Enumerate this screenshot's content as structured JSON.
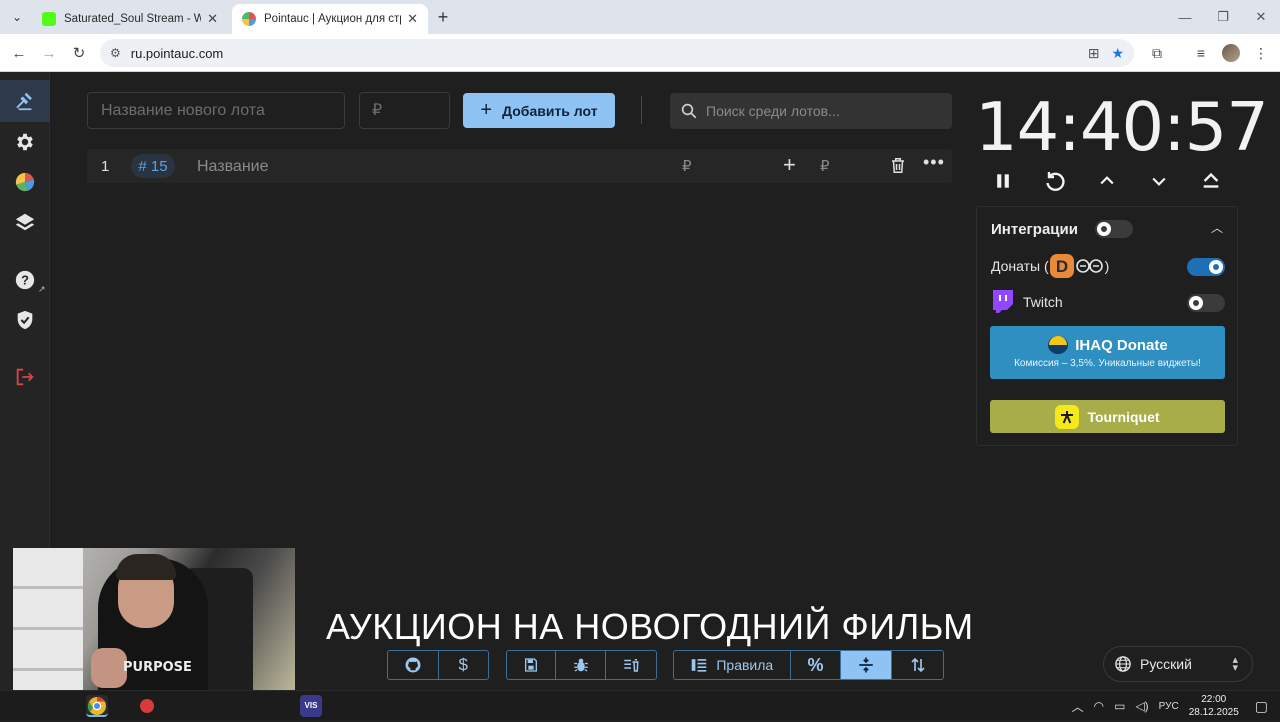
{
  "browser": {
    "tabs": [
      {
        "title": "Saturated_Soul Stream - Watch",
        "active": false,
        "favicon_color": "#53fc18"
      },
      {
        "title": "Pointauc | Аукцион для стриме",
        "active": true,
        "favicon_color": "#e0554a"
      }
    ],
    "url": "ru.pointauc.com"
  },
  "sidebar": {
    "items": [
      {
        "name": "auction",
        "icon": "gavel-icon",
        "active": true
      },
      {
        "name": "settings",
        "icon": "gear-icon"
      },
      {
        "name": "wheel",
        "icon": "pie-wheel-icon"
      },
      {
        "name": "layers",
        "icon": "layers-icon"
      },
      {
        "name": "help",
        "icon": "question-icon"
      },
      {
        "name": "verified",
        "icon": "shield-check-icon"
      },
      {
        "name": "logout",
        "icon": "logout-icon"
      }
    ]
  },
  "toolbar": {
    "lot_name_placeholder": "Название нового лота",
    "amount_placeholder": "₽",
    "add_lot_label": "Добавить лот",
    "search_placeholder": "Поиск среди лотов..."
  },
  "lots": [
    {
      "index": "1",
      "id": "# 15",
      "title": "Название",
      "currency": "₽",
      "add_currency": "₽"
    }
  ],
  "timer": {
    "time": "14:40:57"
  },
  "integrations": {
    "title": "Интеграции",
    "enabled": false,
    "donations_label": "Донаты (",
    "donations_suffix": ")",
    "donations_enabled": true,
    "twitch_label": "Twitch",
    "twitch_enabled": false,
    "ihaq": {
      "title": "IHAQ Donate",
      "subtitle": "Комиссия – 3,5%. Уникальные виджеты!"
    },
    "tourniquet": {
      "title": "Tourniquet"
    }
  },
  "overlay": {
    "title": "АУКЦИОН НА НОВОГОДНИЙ ФИЛЬМ",
    "webcam_shirt_text": "PURPOSE"
  },
  "bottom_bar": {
    "rules_label": "Правила",
    "percent_label": "%"
  },
  "language": {
    "selected": "Русский"
  },
  "taskbar": {
    "lang": "РУС",
    "time": "22:00",
    "date": "28.12.2025"
  },
  "colors": {
    "accent": "#8ec3f3",
    "background": "#1f1f1f",
    "ihaq": "#2f8fc1",
    "tourniquet": "#a8ad4a",
    "switch_on": "#1e6fb6"
  }
}
